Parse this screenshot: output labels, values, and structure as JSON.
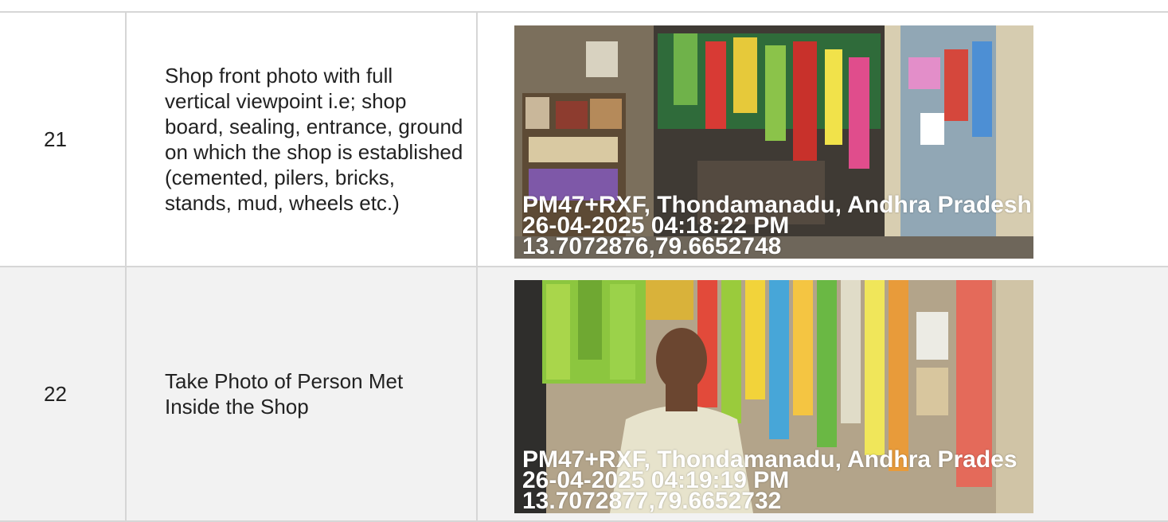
{
  "rows": [
    {
      "number": "21",
      "description": "Shop front photo with full vertical viewpoint i.e; shop board, sealing, entrance, ground on which the shop is established (cemented, pilers, bricks, stands, mud, wheels etc.)",
      "photo": {
        "subject": "shop front",
        "stamp_location": "PM47+RXF, Thondamanadu, Andhra Pradesh",
        "stamp_datetime": "26-04-2025 04:18:22 PM",
        "stamp_coords": "13.7072876,79.6652748"
      }
    },
    {
      "number": "22",
      "description": "Take Photo of Person Met Inside the Shop",
      "photo": {
        "subject": "person inside shop",
        "stamp_location": "PM47+RXF, Thondamanadu, Andhra Prades",
        "stamp_datetime": "26-04-2025 04:19:19 PM",
        "stamp_coords": "13.7072877,79.6652732"
      }
    }
  ]
}
